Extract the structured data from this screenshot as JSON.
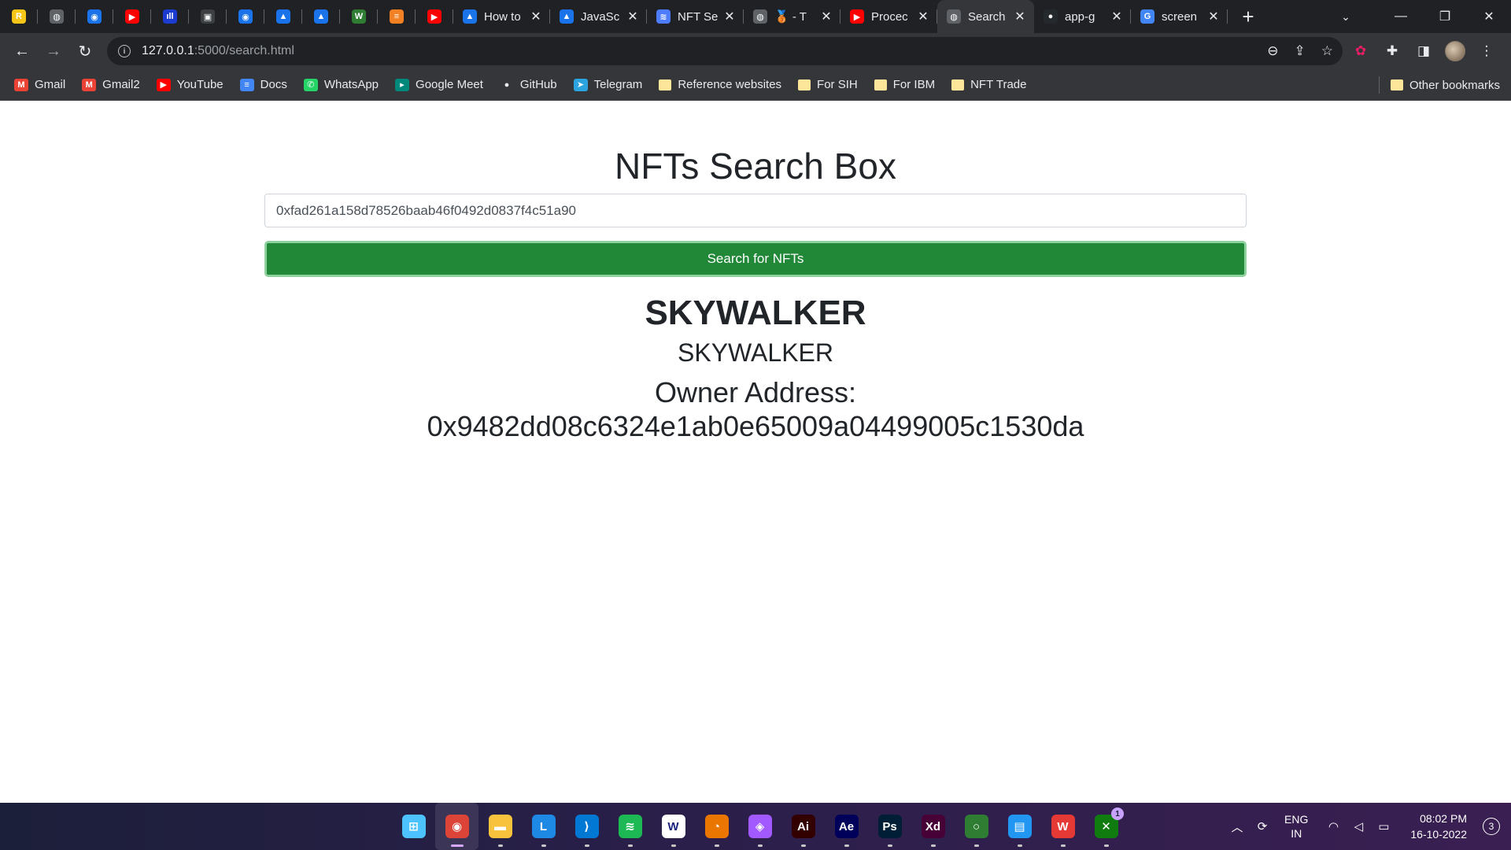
{
  "browser": {
    "pinned_tabs": [
      {
        "icon": "rentry-icon",
        "color": "#f5c518",
        "glyph": "R"
      },
      {
        "icon": "globe-icon",
        "color": "#5f6368",
        "glyph": "◍"
      },
      {
        "icon": "blue-bubble-icon",
        "color": "#1a73e8",
        "glyph": "◉"
      },
      {
        "icon": "youtube-icon",
        "color": "#ff0000",
        "glyph": "▶"
      },
      {
        "icon": "bars-icon",
        "color": "#1b3bd1",
        "glyph": "ıll"
      },
      {
        "icon": "framed-doc-icon",
        "color": "#3c4043",
        "glyph": "▣"
      },
      {
        "icon": "blue-bubble-icon",
        "color": "#1a73e8",
        "glyph": "◉"
      },
      {
        "icon": "triangle-icon",
        "color": "#1a73e8",
        "glyph": "▲"
      },
      {
        "icon": "triangle-icon",
        "color": "#1a73e8",
        "glyph": "▲"
      },
      {
        "icon": "w-icon",
        "color": "#2e7d32",
        "glyph": "W"
      },
      {
        "icon": "stackoverflow-icon",
        "color": "#f48024",
        "glyph": "≡"
      },
      {
        "icon": "youtube-icon",
        "color": "#ff0000",
        "glyph": "▶"
      }
    ],
    "tabs": [
      {
        "title": "How to",
        "icon": "triangle-icon",
        "color": "#1a73e8",
        "glyph": "▲",
        "active": false
      },
      {
        "title": "JavaSc",
        "icon": "triangle-icon",
        "color": "#1a73e8",
        "glyph": "▲",
        "active": false
      },
      {
        "title": "NFT Se",
        "icon": "opensea-lines-icon",
        "color": "#4d7cfe",
        "glyph": "≋",
        "active": false
      },
      {
        "title": "🥉 - T",
        "icon": "globe-icon",
        "color": "#5f6368",
        "glyph": "◍",
        "active": false
      },
      {
        "title": "Procec",
        "icon": "youtube-icon",
        "color": "#ff0000",
        "glyph": "▶",
        "active": false
      },
      {
        "title": "Search",
        "icon": "globe-icon",
        "color": "#5f6368",
        "glyph": "◍",
        "active": true
      },
      {
        "title": "app-g",
        "icon": "github-icon",
        "color": "#24292e",
        "glyph": "●",
        "active": false
      },
      {
        "title": "screen",
        "icon": "google-icon",
        "color": "#4285f4",
        "glyph": "G",
        "active": false
      }
    ],
    "url_host": "127.0.0.1",
    "url_path": ":5000/search.html",
    "bookmarks": [
      {
        "label": "Gmail",
        "icon": "gmail-icon",
        "color": "#ea4335",
        "glyph": "M"
      },
      {
        "label": "Gmail2",
        "icon": "gmail-icon",
        "color": "#ea4335",
        "glyph": "M"
      },
      {
        "label": "YouTube",
        "icon": "youtube-icon",
        "color": "#ff0000",
        "glyph": "▶"
      },
      {
        "label": "Docs",
        "icon": "docs-icon",
        "color": "#4285f4",
        "glyph": "≡"
      },
      {
        "label": "WhatsApp",
        "icon": "whatsapp-icon",
        "color": "#25d366",
        "glyph": "✆"
      },
      {
        "label": "Google Meet",
        "icon": "meet-icon",
        "color": "#00897b",
        "glyph": "▸"
      },
      {
        "label": "GitHub",
        "icon": "github-icon",
        "color": "#e8eaed",
        "glyph": "●"
      },
      {
        "label": "Telegram",
        "icon": "telegram-icon",
        "color": "#2aa3df",
        "glyph": "➤"
      },
      {
        "label": "Reference websites",
        "icon": "folder-icon",
        "folder": true
      },
      {
        "label": "For SIH",
        "icon": "folder-icon",
        "folder": true
      },
      {
        "label": "For IBM",
        "icon": "folder-icon",
        "folder": true
      },
      {
        "label": "NFT Trade",
        "icon": "folder-icon",
        "folder": true
      }
    ],
    "other_bookmarks": "Other bookmarks"
  },
  "page": {
    "title": "NFTs Search Box",
    "search_value": "0xfad261a158d78526baab46f0492d0837f4c51a90",
    "search_button": "Search for NFTs",
    "nft_name": "SKYWALKER",
    "nft_symbol": "SKYWALKER",
    "owner_label": "Owner Address:",
    "owner_address": "0x9482dd08c6324e1ab0e65009a04499005c1530da"
  },
  "taskbar": {
    "apps": [
      {
        "name": "windows-start-icon",
        "color": "#4cc2ff",
        "glyph": "⊞"
      },
      {
        "name": "chrome-icon",
        "color": "#db4437",
        "glyph": "◉",
        "active": true
      },
      {
        "name": "file-explorer-icon",
        "color": "#f9c23c",
        "glyph": "▬"
      },
      {
        "name": "l-app-icon",
        "color": "#1e88e5",
        "glyph": "L"
      },
      {
        "name": "vscode-icon",
        "color": "#0078d4",
        "glyph": "⟩"
      },
      {
        "name": "spotify-icon",
        "color": "#1db954",
        "glyph": "≋"
      },
      {
        "name": "w-circle-icon",
        "color": "#ffffff",
        "glyph": "W"
      },
      {
        "name": "blender-icon",
        "color": "#ea7600",
        "glyph": "◔"
      },
      {
        "name": "figma-icon",
        "color": "#a259ff",
        "glyph": "◈"
      },
      {
        "name": "illustrator-icon",
        "color": "#330000",
        "glyph": "Ai"
      },
      {
        "name": "after-effects-icon",
        "color": "#00005b",
        "glyph": "Ae"
      },
      {
        "name": "photoshop-icon",
        "color": "#001e36",
        "glyph": "Ps"
      },
      {
        "name": "adobe-xd-icon",
        "color": "#470137",
        "glyph": "Xd"
      },
      {
        "name": "ring-app-icon",
        "color": "#2e7d32",
        "glyph": "○"
      },
      {
        "name": "notepad-icon",
        "color": "#2196f3",
        "glyph": "▤"
      },
      {
        "name": "wps-icon",
        "color": "#e53935",
        "glyph": "W"
      },
      {
        "name": "xbox-icon",
        "color": "#107c10",
        "glyph": "✕",
        "badge": "1"
      }
    ],
    "lang_top": "ENG",
    "lang_bottom": "IN",
    "time": "08:02 PM",
    "date": "16-10-2022",
    "notifications": "3"
  }
}
